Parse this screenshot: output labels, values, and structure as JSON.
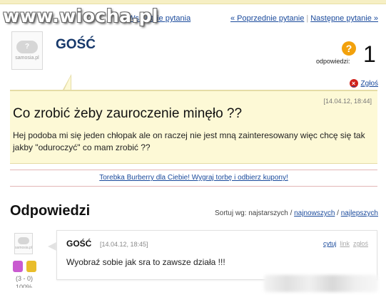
{
  "watermark": "www.wiocha.pl",
  "header": {
    "back_link": "« Wszystkie pytania",
    "prev_question": "« Poprzednie pytanie",
    "next_question": "Następne pytanie »"
  },
  "question": {
    "author": "GOŚĆ",
    "avatar_caption": "samosia.pl",
    "answers_label": "odpowiedzi:",
    "answers_count": "1",
    "report_label": "Zgłoś",
    "date": "[14.04.12, 18:44]",
    "title": "Co zrobić żeby zauroczenie minęło ??",
    "body": "Hej podoba mi się jeden chłopak ale on raczej nie jest mną zainteresowany więc chcę się tak jakby \"oduroczyć\" co mam zrobić ??"
  },
  "promo": {
    "text": "Torebka Burberry dla Ciebie! Wygraj torbę i odbierz kupony!"
  },
  "answers_section": {
    "title": "Odpowiedzi",
    "sort_label": "Sortuj wg: najstarszych /",
    "sort_newest": "najnowszych",
    "sort_sep": "/",
    "sort_best": "najlepszych"
  },
  "answer": {
    "author": "GOŚĆ",
    "date": "[14.04.12, 18:45]",
    "quote": "cytuj",
    "link": "link",
    "report": "zgłoś",
    "text": "Wyobraź sobie jak sra to zawsze działa !!!",
    "votes": "(3 - 0)",
    "percent": "100%"
  },
  "colors": {
    "link": "#1a4a9c",
    "question_bg": "#fdf9d6",
    "accent_orange": "#f2a10c"
  }
}
